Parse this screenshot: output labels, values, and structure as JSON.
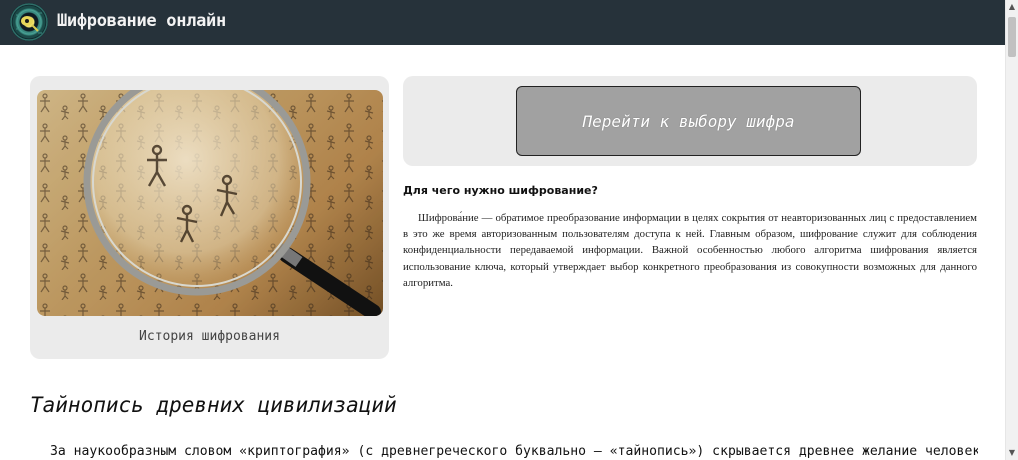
{
  "header": {
    "title": "Шифрование онлайн",
    "logo_icon": "cipher-logo-icon"
  },
  "left_card": {
    "image_icon": "magnifier-image",
    "caption": "История шифрования"
  },
  "right_card": {
    "button_label": "Перейти к выбору шифра"
  },
  "article": {
    "question": "Для чего нужно шифрование?",
    "paragraph": "Шифрова́ние — обратимое преобразование информации в целях сокрытия от неавторизованных лиц с предоставлением в это же время авторизованным пользователям доступа к ней. Главным образом, шифрование служит для соблюдения конфиденциальности передаваемой информации. Важной особенностью любого алгоритма шифрования является использование ключа, который утверждает выбор конкретного преобразования из совокупности возможных для данного алгоритма."
  },
  "section": {
    "title": "Тайнопись древних цивилизаций",
    "text": "За наукообразным словом «криптография» (с древнегреческого буквально – «тайнопись») скрывается древнее желание человека"
  },
  "colors": {
    "header_bg": "#26323a",
    "card_bg": "#ebebeb",
    "button_bg": "#a1a1a1"
  }
}
